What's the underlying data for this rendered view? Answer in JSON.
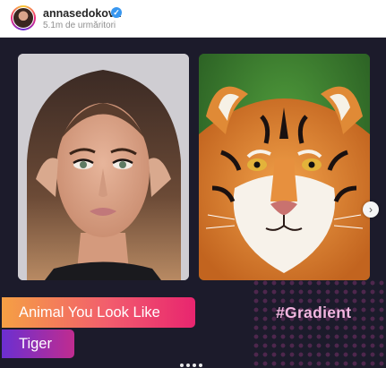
{
  "header": {
    "username": "annasedokova",
    "verified_icon": "verified-badge-icon",
    "followers": "5.1m de urmăritori"
  },
  "post": {
    "left_photo": "woman-portrait",
    "right_photo": "tiger-portrait",
    "title": "Animal You Look Like",
    "result": "Tiger",
    "hashtag": "#Gradient",
    "next_icon": "chevron-right-icon",
    "pager_count": 4,
    "colors": {
      "background": "#1c1b2b",
      "title_gradient_start": "#f5a044",
      "title_gradient_end": "#e8256f",
      "result_gradient_start": "#6b2fd1",
      "result_gradient_end": "#c02c8f",
      "hashtag": "#f3b6e0"
    }
  }
}
